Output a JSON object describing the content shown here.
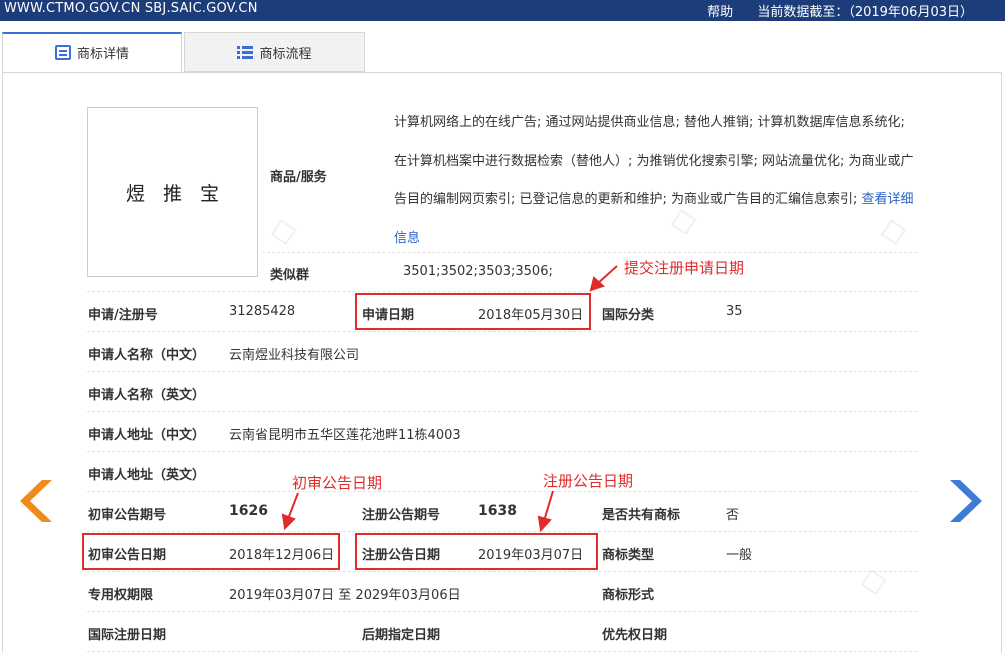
{
  "topbar": {
    "site": "WWW.CTMO.GOV.CN SBJ.SAIC.GOV.CN",
    "help": "帮助",
    "data_date": "当前数据截至：（2019年06月03日）"
  },
  "tabs": [
    {
      "label": "商标详情"
    },
    {
      "label": "商标流程"
    }
  ],
  "trademark": {
    "image_text": "煜推宝",
    "goods_label": "商品/服务",
    "goods_text": "计算机网络上的在线广告; 通过网站提供商业信息; 替他人推销; 计算机数据库信息系统化; 在计算机档案中进行数据检索（替他人）; 为推销优化搜索引擎; 网站流量优化; 为商业或广告目的编制网页索引; 已登记信息的更新和维护; 为商业或广告目的汇编信息索引;",
    "goods_link": "查看详细信息",
    "similar_label": "类似群",
    "similar_value": "3501;3502;3503;3506;"
  },
  "fields": {
    "reg_no_label": "申请/注册号",
    "reg_no": "31285428",
    "app_date_label": "申请日期",
    "app_date": "2018年05月30日",
    "intl_class_label": "国际分类",
    "intl_class": "35",
    "applicant_cn_label": "申请人名称（中文）",
    "applicant_cn": "云南煜业科技有限公司",
    "applicant_en_label": "申请人名称（英文）",
    "address_cn_label": "申请人地址（中文）",
    "address_cn": "云南省昆明市五华区莲花池畔11栋4003",
    "address_en_label": "申请人地址（英文）",
    "prelim_no_label": "初审公告期号",
    "prelim_no": "1626",
    "reg_pub_no_label": "注册公告期号",
    "reg_pub_no": "1638",
    "shared_label": "是否共有商标",
    "shared": "否",
    "prelim_date_label": "初审公告日期",
    "prelim_date": "2018年12月06日",
    "reg_pub_date_label": "注册公告日期",
    "reg_pub_date": "2019年03月07日",
    "tm_type_label": "商标类型",
    "tm_type": "一般",
    "exclusive_label": "专用权期限",
    "exclusive": "2019年03月07日 至 2029年03月06日",
    "tm_form_label": "商标形式",
    "intl_reg_date_label": "国际注册日期",
    "later_date_label": "后期指定日期",
    "priority_label": "优先权日期"
  },
  "annotations": {
    "submit_date": "提交注册申请日期",
    "prelim_date": "初审公告日期",
    "reg_date": "注册公告日期"
  },
  "colors": {
    "topbar": "#1d3d7a",
    "annotation": "#e02b2b",
    "left_arrow": "#f08a1c",
    "right_arrow": "#3f7ad6"
  }
}
